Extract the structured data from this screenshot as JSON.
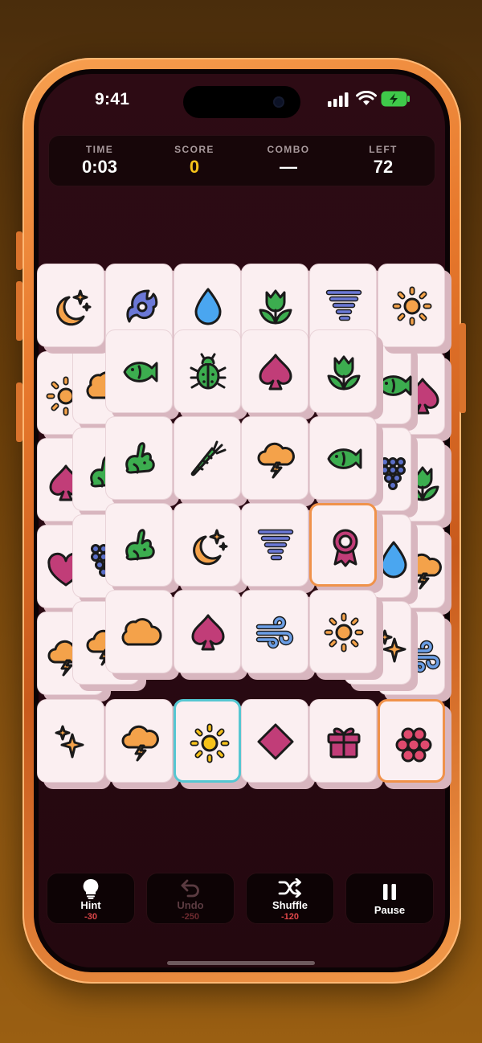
{
  "status_bar": {
    "time": "9:41"
  },
  "stats": {
    "time": {
      "label": "TIME",
      "value": "0:03"
    },
    "score": {
      "label": "SCORE",
      "value": "0"
    },
    "combo": {
      "label": "COMBO",
      "value": "—"
    },
    "left": {
      "label": "LEFT",
      "value": "72"
    }
  },
  "colors": {
    "accent_orange": "#f0924a",
    "accent_teal": "#55c7d2",
    "score_yellow": "#f6c21a",
    "cost_red": "#e0474a"
  },
  "board": {
    "top_layer_visible": [
      {
        "icon": "moon-stars-icon"
      },
      {
        "icon": "hurricane-icon"
      },
      {
        "icon": "water-drop-icon"
      },
      {
        "icon": "tulip-icon"
      },
      {
        "icon": "tornado-icon"
      },
      {
        "icon": "sun-icon"
      },
      {
        "icon": "fish-icon"
      },
      {
        "icon": "bug-icon"
      },
      {
        "icon": "spade-icon"
      },
      {
        "icon": "tulip-icon"
      },
      {
        "icon": "rabbit-icon"
      },
      {
        "icon": "carrot-icon"
      },
      {
        "icon": "storm-cloud-icon"
      },
      {
        "icon": "fish-icon"
      },
      {
        "icon": "rabbit-icon"
      },
      {
        "icon": "moon-stars-icon"
      },
      {
        "icon": "tornado-icon"
      },
      {
        "icon": "ribbon-badge-icon",
        "selected": "orange"
      },
      {
        "icon": "cloud-icon"
      },
      {
        "icon": "spade-icon"
      },
      {
        "icon": "wind-icon"
      },
      {
        "icon": "sun-icon"
      },
      {
        "icon": "sparkles-icon"
      },
      {
        "icon": "storm-cloud-icon"
      },
      {
        "icon": "sun-icon",
        "selected": "teal"
      },
      {
        "icon": "diamond-icon"
      },
      {
        "icon": "gift-icon"
      },
      {
        "icon": "berries-icon",
        "selected": "orange"
      }
    ]
  },
  "controls": {
    "hint": {
      "label": "Hint",
      "cost": "-30",
      "icon": "lightbulb-icon"
    },
    "undo": {
      "label": "Undo",
      "cost": "-250",
      "icon": "undo-icon",
      "disabled": true
    },
    "shuffle": {
      "label": "Shuffle",
      "cost": "-120",
      "icon": "shuffle-icon"
    },
    "pause": {
      "label": "Pause",
      "icon": "pause-icon"
    }
  }
}
